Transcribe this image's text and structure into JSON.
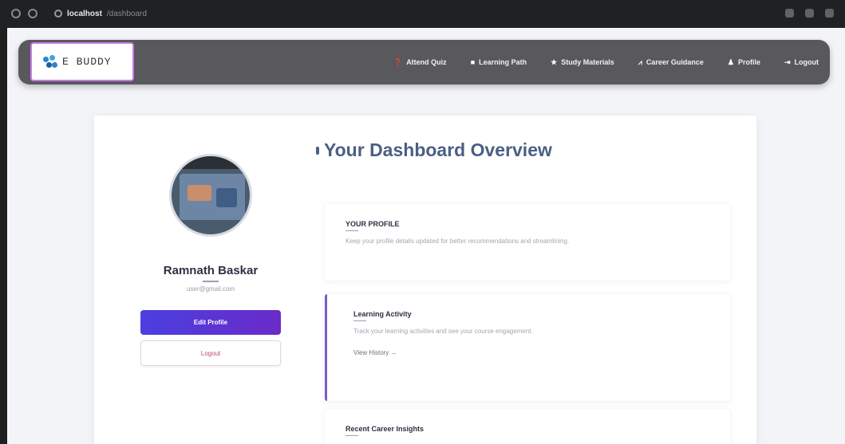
{
  "browser": {
    "host": "localhost",
    "path": "/dashboard"
  },
  "brand": {
    "logo_text": "E BUDDY",
    "accent": "#c77ce6"
  },
  "nav": {
    "items": [
      {
        "icon": "question-circle-icon",
        "glyph": "❓",
        "label": "Attend Quiz"
      },
      {
        "icon": "book-icon",
        "glyph": "■",
        "label": "Learning Path"
      },
      {
        "icon": "star-icon",
        "glyph": "★",
        "label": "Study Materials"
      },
      {
        "icon": "chart-icon",
        "glyph": "⩘",
        "label": "Career Guidance"
      },
      {
        "icon": "user-icon",
        "glyph": "♟",
        "label": "Profile"
      },
      {
        "icon": "logout-icon",
        "glyph": "⇥",
        "label": "Logout"
      }
    ]
  },
  "profile": {
    "name": "Ramnath Baskar",
    "email": "user@gmail.com",
    "edit_label": "Edit Profile",
    "logout_label": "Logout"
  },
  "dashboard": {
    "title": "Your Dashboard Overview",
    "sections": [
      {
        "title": "YOUR PROFILE",
        "desc": "Keep your profile details updated for better recommendations and streamlining."
      },
      {
        "title": "Learning Activity",
        "desc": "Track your learning activities and see your course engagement.",
        "link": "View History →"
      },
      {
        "title": "Recent Career Insights"
      }
    ]
  }
}
